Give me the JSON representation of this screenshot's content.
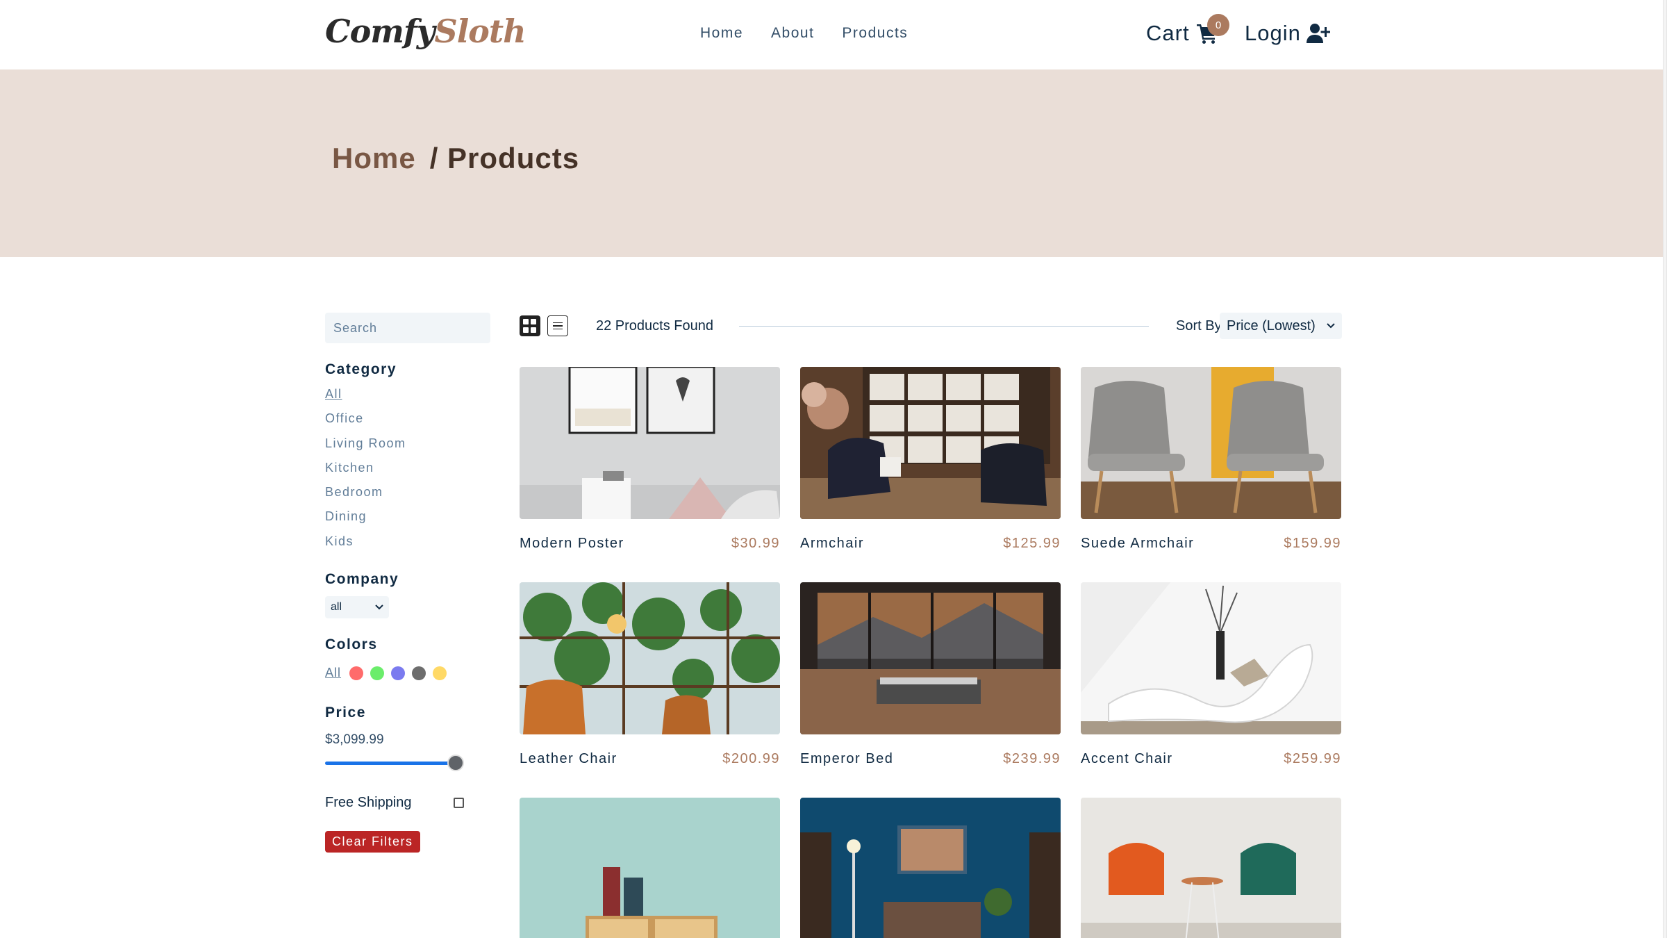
{
  "nav": {
    "logo_part1": "Comfy",
    "logo_part2": "Sloth",
    "links": [
      "Home",
      "About",
      "Products"
    ],
    "cart_label": "Cart",
    "cart_count": "0",
    "login_label": "Login"
  },
  "hero": {
    "crumb_home": "Home",
    "crumb_current": "/ Products"
  },
  "filters": {
    "search_placeholder": "Search",
    "category_title": "Category",
    "categories": [
      "All",
      "Office",
      "Living Room",
      "Kitchen",
      "Bedroom",
      "Dining",
      "Kids"
    ],
    "company_title": "Company",
    "company_value": "all",
    "colors_title": "Colors",
    "colors_all": "All",
    "colors": [
      "#ff6b6b",
      "#6bed6b",
      "#7b7bef",
      "#6d6d6d",
      "#ffd966"
    ],
    "price_title": "Price",
    "price_value": "$3,099.99",
    "price_fraction": 1.0,
    "free_shipping_label": "Free Shipping",
    "clear_label": "Clear Filters"
  },
  "toolbar": {
    "found_text": "22 Products Found",
    "sort_label": "Sort By",
    "sort_value": "Price (Lowest)"
  },
  "products": [
    {
      "name": "Modern Poster",
      "price": "$30.99"
    },
    {
      "name": "Armchair",
      "price": "$125.99"
    },
    {
      "name": "Suede Armchair",
      "price": "$159.99"
    },
    {
      "name": "Leather Chair",
      "price": "$200.99"
    },
    {
      "name": "Emperor Bed",
      "price": "$239.99"
    },
    {
      "name": "Accent Chair",
      "price": "$259.99"
    },
    {
      "name": "",
      "price": ""
    },
    {
      "name": "",
      "price": ""
    },
    {
      "name": "",
      "price": ""
    }
  ]
}
